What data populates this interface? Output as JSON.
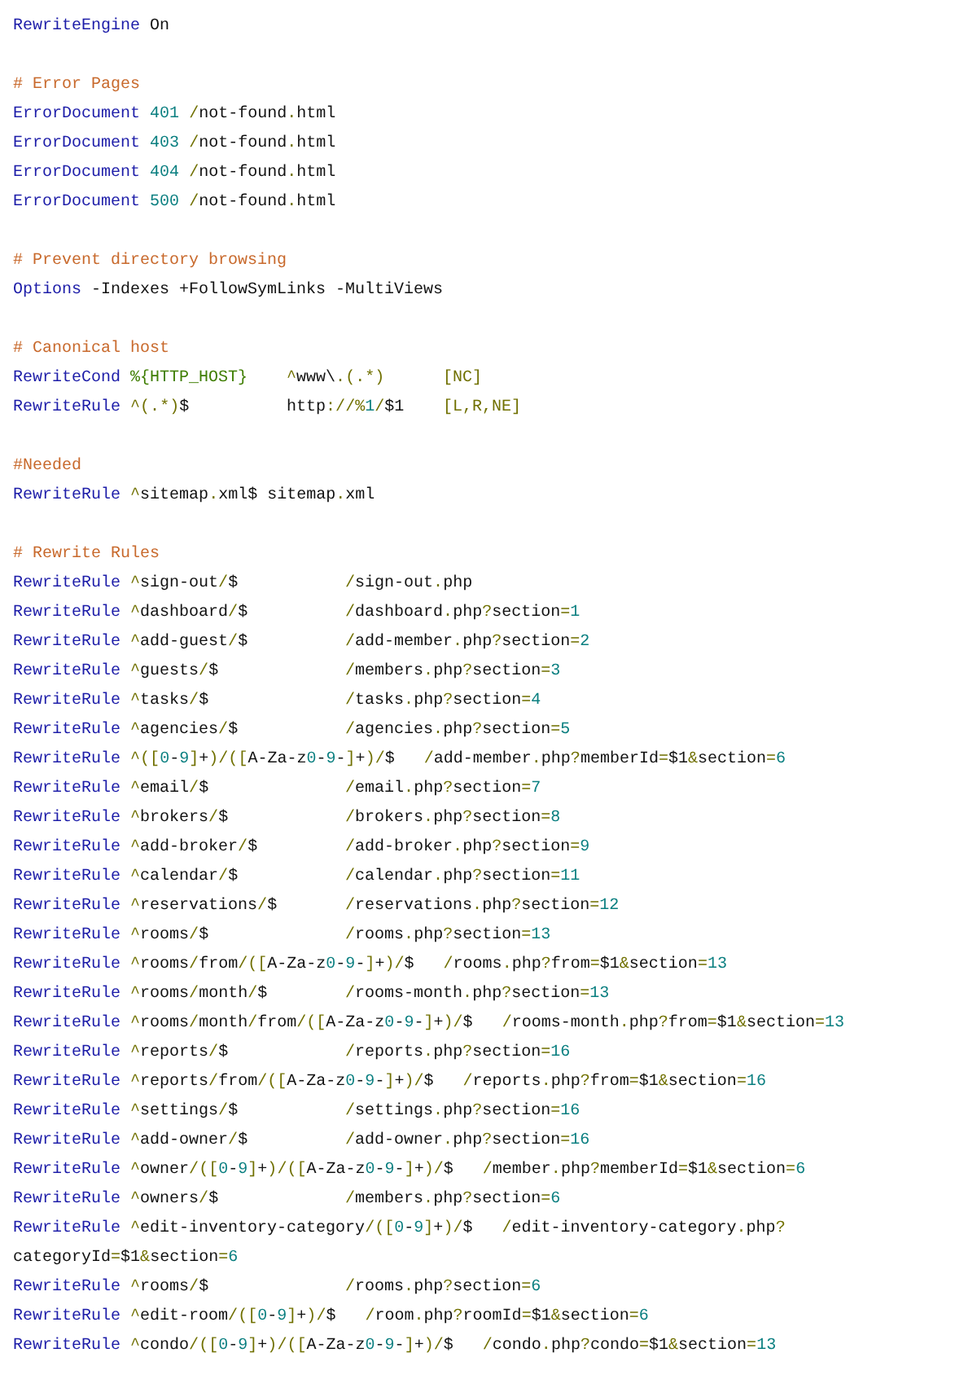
{
  "sections": [
    {
      "lines": [
        {
          "kind": "directive",
          "name": "RewriteEngine",
          "args": " On"
        }
      ]
    },
    {
      "comment": "# Error Pages",
      "lines": [
        {
          "kind": "directive",
          "name": "ErrorDocument",
          "args": " 401 /not-found.html"
        },
        {
          "kind": "directive",
          "name": "ErrorDocument",
          "args": " 403 /not-found.html"
        },
        {
          "kind": "directive",
          "name": "ErrorDocument",
          "args": " 404 /not-found.html"
        },
        {
          "kind": "directive",
          "name": "ErrorDocument",
          "args": " 500 /not-found.html"
        }
      ]
    },
    {
      "comment": "# Prevent directory browsing",
      "lines": [
        {
          "kind": "directive",
          "name": "Options",
          "args": " -Indexes +FollowSymLinks -MultiViews"
        }
      ]
    },
    {
      "comment": "# Canonical host",
      "lines": [
        {
          "kind": "rule3",
          "name": "RewriteCond",
          "pattern": "%{HTTP_HOST}",
          "target": "^www\\.(.*)",
          "flags": "[NC]"
        },
        {
          "kind": "rule3",
          "name": "RewriteRule",
          "pattern": "^(.*)$",
          "target": "http://%1/$1",
          "flags": "[L,R,NE]"
        }
      ]
    },
    {
      "comment": "#Needed",
      "lines": [
        {
          "kind": "directive",
          "name": "RewriteRule",
          "args": " ^sitemap.xml$ sitemap.xml"
        }
      ]
    },
    {
      "comment": "# Rewrite Rules",
      "lines": [
        {
          "kind": "rule",
          "name": "RewriteRule",
          "pattern": "^sign-out/$",
          "target": "/sign-out.php"
        },
        {
          "kind": "rule",
          "name": "RewriteRule",
          "pattern": "^dashboard/$",
          "target": "/dashboard.php?section=1"
        },
        {
          "kind": "rule",
          "name": "RewriteRule",
          "pattern": "^add-guest/$",
          "target": "/add-member.php?section=2"
        },
        {
          "kind": "rule",
          "name": "RewriteRule",
          "pattern": "^guests/$",
          "target": "/members.php?section=3"
        },
        {
          "kind": "rule",
          "name": "RewriteRule",
          "pattern": "^tasks/$",
          "target": "/tasks.php?section=4"
        },
        {
          "kind": "rule",
          "name": "RewriteRule",
          "pattern": "^agencies/$",
          "target": "/agencies.php?section=5"
        },
        {
          "kind": "rule",
          "name": "RewriteRule",
          "pattern": "^([0-9]+)/([A-Za-z0-9-]+)/$",
          "target": "/add-member.php?memberId=$1&section=6"
        },
        {
          "kind": "rule",
          "name": "RewriteRule",
          "pattern": "^email/$",
          "target": "/email.php?section=7"
        },
        {
          "kind": "rule",
          "name": "RewriteRule",
          "pattern": "^brokers/$",
          "target": "/brokers.php?section=8"
        },
        {
          "kind": "rule",
          "name": "RewriteRule",
          "pattern": "^add-broker/$",
          "target": "/add-broker.php?section=9"
        },
        {
          "kind": "rule",
          "name": "RewriteRule",
          "pattern": "^calendar/$",
          "target": "/calendar.php?section=11"
        },
        {
          "kind": "rule",
          "name": "RewriteRule",
          "pattern": "^reservations/$",
          "target": "/reservations.php?section=12"
        },
        {
          "kind": "rule",
          "name": "RewriteRule",
          "pattern": "^rooms/$",
          "target": "/rooms.php?section=13"
        },
        {
          "kind": "rule",
          "name": "RewriteRule",
          "pattern": "^rooms/from/([A-Za-z0-9-]+)/$",
          "target": "/rooms.php?from=$1&section=13"
        },
        {
          "kind": "rule",
          "name": "RewriteRule",
          "pattern": "^rooms/month/$",
          "target": "/rooms-month.php?section=13"
        },
        {
          "kind": "rule",
          "name": "RewriteRule",
          "pattern": "^rooms/month/from/([A-Za-z0-9-]+)/$",
          "target": "/rooms-month.php?from=$1&section=13"
        },
        {
          "kind": "rule",
          "name": "RewriteRule",
          "pattern": "^reports/$",
          "target": "/reports.php?section=16"
        },
        {
          "kind": "rule",
          "name": "RewriteRule",
          "pattern": "^reports/from/([A-Za-z0-9-]+)/$",
          "target": "/reports.php?from=$1&section=16"
        },
        {
          "kind": "rule",
          "name": "RewriteRule",
          "pattern": "^settings/$",
          "target": "/settings.php?section=16"
        },
        {
          "kind": "rule",
          "name": "RewriteRule",
          "pattern": "^add-owner/$",
          "target": "/add-owner.php?section=16"
        },
        {
          "kind": "rule",
          "name": "RewriteRule",
          "pattern": "^owner/([0-9]+)/([A-Za-z0-9-]+)/$",
          "target": "/member.php?memberId=$1&section=6"
        },
        {
          "kind": "rule",
          "name": "RewriteRule",
          "pattern": "^owners/$",
          "target": "/members.php?section=6"
        },
        {
          "kind": "rule",
          "name": "RewriteRule",
          "pattern": "^edit-inventory-category/([0-9]+)/$",
          "target": "/edit-inventory-category.php?"
        },
        {
          "kind": "continuation",
          "args": "categoryId=$1&section=6"
        },
        {
          "kind": "rule",
          "name": "RewriteRule",
          "pattern": "^rooms/$",
          "target": "/rooms.php?section=6"
        },
        {
          "kind": "rule",
          "name": "RewriteRule",
          "pattern": "^edit-room/([0-9]+)/$",
          "target": "/room.php?roomId=$1&section=6"
        },
        {
          "kind": "rule",
          "name": "RewriteRule",
          "pattern": "^condo/([0-9]+)/([A-Za-z0-9-]+)/$",
          "target": "/condo.php?condo=$1&section=13"
        }
      ]
    }
  ]
}
